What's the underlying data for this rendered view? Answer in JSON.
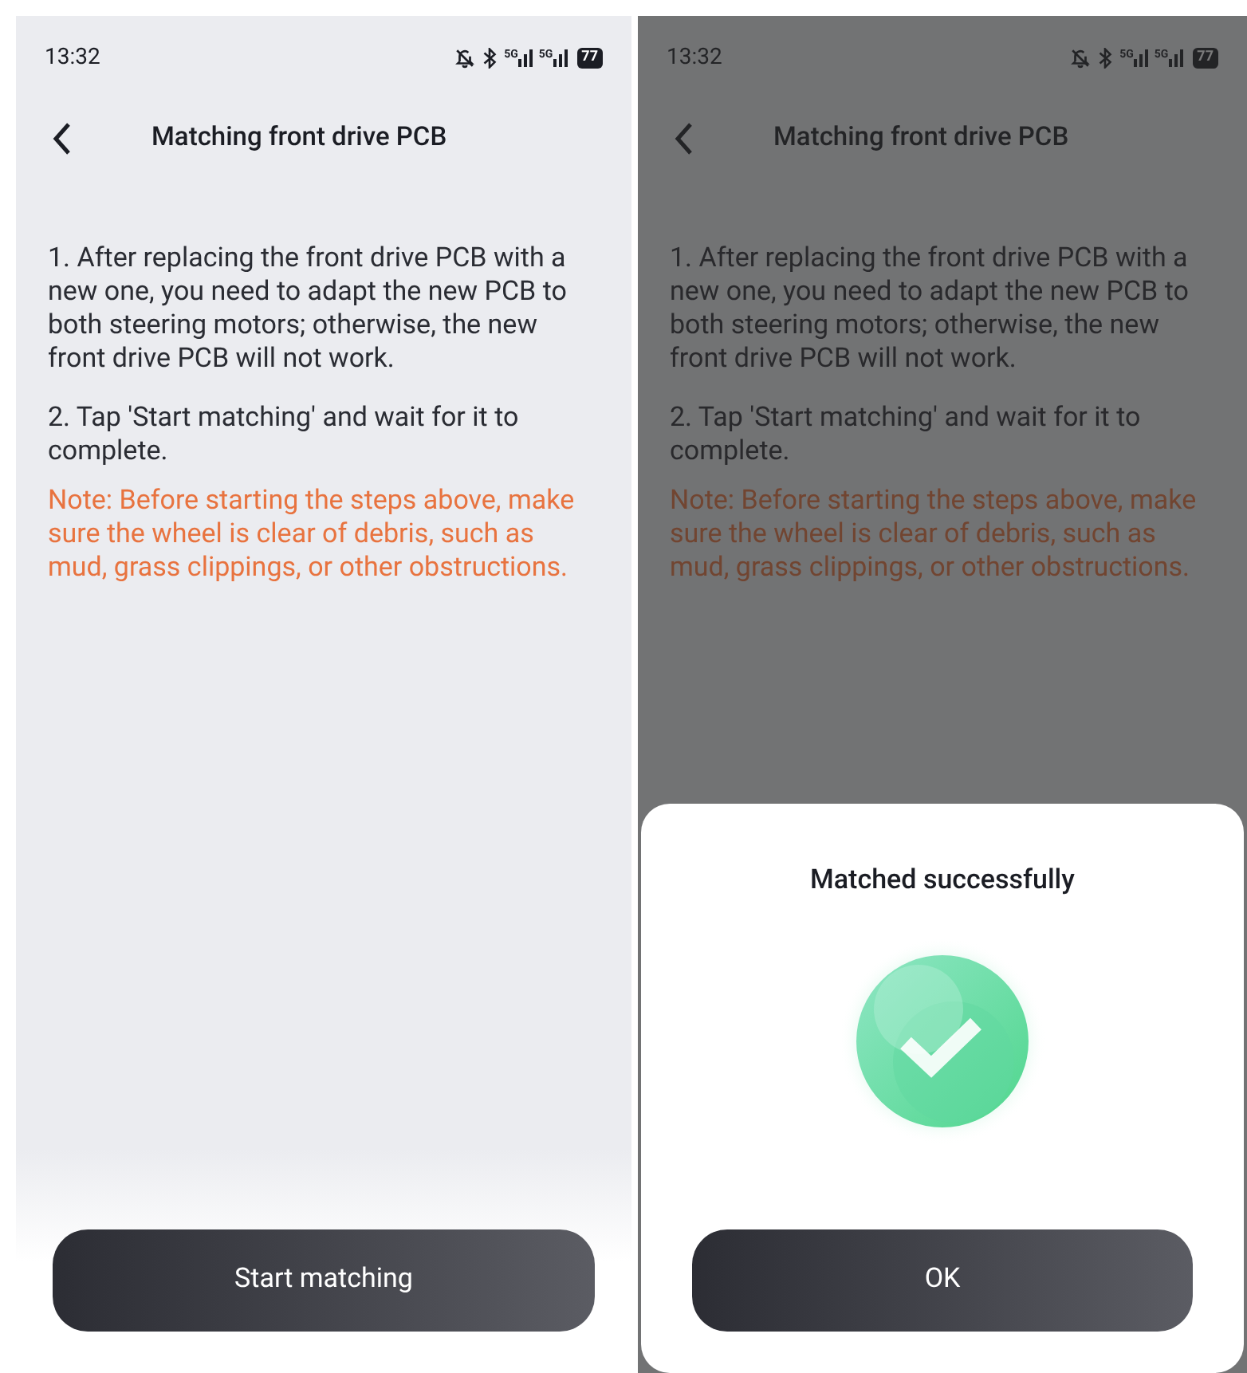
{
  "screens": [
    {
      "dimmed": false,
      "status_bar": {
        "time": "13:32",
        "network_labels": [
          "5G",
          "5G"
        ],
        "battery": "77"
      },
      "title": "Matching front drive PCB",
      "steps": [
        "1. After replacing the front drive PCB with a new one, you need to adapt the new PCB to both steering motors; otherwise, the new front drive PCB will not work.",
        "2. Tap 'Start matching' and wait for it to complete."
      ],
      "note": "Note: Before starting the steps above, make sure the wheel is clear of debris, such as mud, grass clippings, or other obstructions.",
      "bottom_button": "Start matching"
    },
    {
      "dimmed": true,
      "status_bar": {
        "time": "13:32",
        "network_labels": [
          "5G",
          "5G"
        ],
        "battery": "77"
      },
      "title": "Matching front drive PCB",
      "steps": [
        "1. After replacing the front drive PCB with a new one, you need to adapt the new PCB to both steering motors; otherwise, the new front drive PCB will not work.",
        "2. Tap 'Start matching' and wait for it to complete."
      ],
      "note": "Note: Before starting the steps above, make sure the wheel is clear of debris, such as mud, grass clippings, or other obstructions.",
      "dialog": {
        "title": "Matched successfully",
        "button": "OK"
      }
    }
  ]
}
